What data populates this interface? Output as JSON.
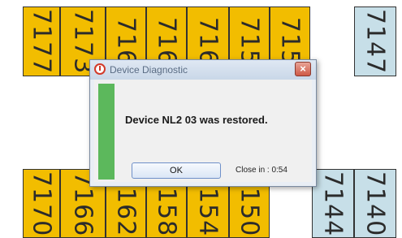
{
  "tiles_top": [
    "7177",
    "7173",
    "716",
    "716",
    "716",
    "715",
    "715",
    "7147"
  ],
  "tiles_bottom": [
    "7170",
    "7166",
    "7162",
    "7158",
    "7154",
    "7150",
    "7144",
    "7140"
  ],
  "dialog": {
    "title": "Device Diagnostic",
    "close_label": "×",
    "message": "Device NL2 03 was restored.",
    "ok_label": "OK",
    "countdown": "Close in : 0:54",
    "status_color": "#5cb85c"
  },
  "colors": {
    "tile_yellow": "#f2bd00",
    "tile_blue": "#c7dfe8"
  }
}
